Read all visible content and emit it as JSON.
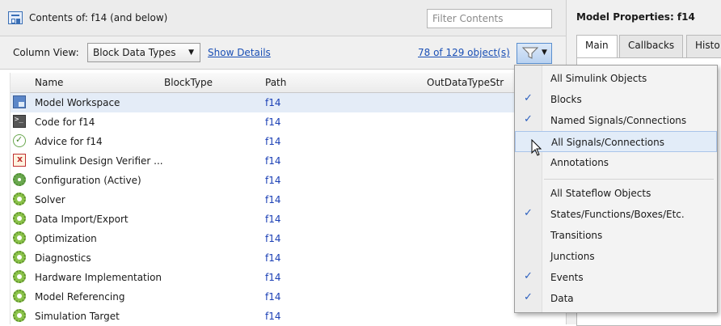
{
  "header": {
    "contents_label": "Contents of: f14  (and below)",
    "filter_placeholder": "Filter Contents"
  },
  "toolbar": {
    "column_view_label": "Column View:",
    "column_view_value": "Block Data Types",
    "show_details": "Show Details",
    "object_count": "78 of 129 object(s)"
  },
  "table": {
    "columns": [
      "Name",
      "BlockType",
      "Path",
      "OutDataTypeStr"
    ],
    "rows": [
      {
        "name": "Model Workspace",
        "path": "f14",
        "icon": "model-workspace-icon"
      },
      {
        "name": "Code for f14",
        "path": "f14",
        "icon": "code-icon"
      },
      {
        "name": "Advice for f14",
        "path": "f14",
        "icon": "advisor-icon"
      },
      {
        "name": "Simulink Design Verifier ...",
        "path": "f14",
        "icon": "design-verifier-icon"
      },
      {
        "name": "Configuration (Active)",
        "path": "f14",
        "icon": "configuration-icon"
      },
      {
        "name": "Solver",
        "path": "f14",
        "icon": "gear-icon"
      },
      {
        "name": "Data Import/Export",
        "path": "f14",
        "icon": "gear-icon"
      },
      {
        "name": "Optimization",
        "path": "f14",
        "icon": "gear-icon"
      },
      {
        "name": "Diagnostics",
        "path": "f14",
        "icon": "gear-icon"
      },
      {
        "name": "Hardware Implementation",
        "path": "f14",
        "icon": "gear-icon"
      },
      {
        "name": "Model Referencing",
        "path": "f14",
        "icon": "gear-icon"
      },
      {
        "name": "Simulation Target",
        "path": "f14",
        "icon": "gear-icon"
      }
    ]
  },
  "properties": {
    "title": "Model Properties: f14",
    "tabs": [
      "Main",
      "Callbacks",
      "Histo"
    ]
  },
  "filter_menu": {
    "items": [
      {
        "label": "All Simulink Objects",
        "checked": false
      },
      {
        "label": "Blocks",
        "checked": true
      },
      {
        "label": "Named Signals/Connections",
        "checked": true
      },
      {
        "label": "All Signals/Connections",
        "checked": false,
        "hover": true
      },
      {
        "label": "Annotations",
        "checked": false
      },
      {
        "label": "All Stateflow Objects",
        "checked": false
      },
      {
        "label": "States/Functions/Boxes/Etc.",
        "checked": true
      },
      {
        "label": "Transitions",
        "checked": false
      },
      {
        "label": "Junctions",
        "checked": false
      },
      {
        "label": "Events",
        "checked": true
      },
      {
        "label": "Data",
        "checked": true
      }
    ]
  },
  "colors": {
    "link": "#1a4fb5",
    "path": "#1a3fb5",
    "check": "#2b5fbe",
    "selected_row": "#e4ecf7",
    "menu_hover": "#e2ecf8"
  }
}
